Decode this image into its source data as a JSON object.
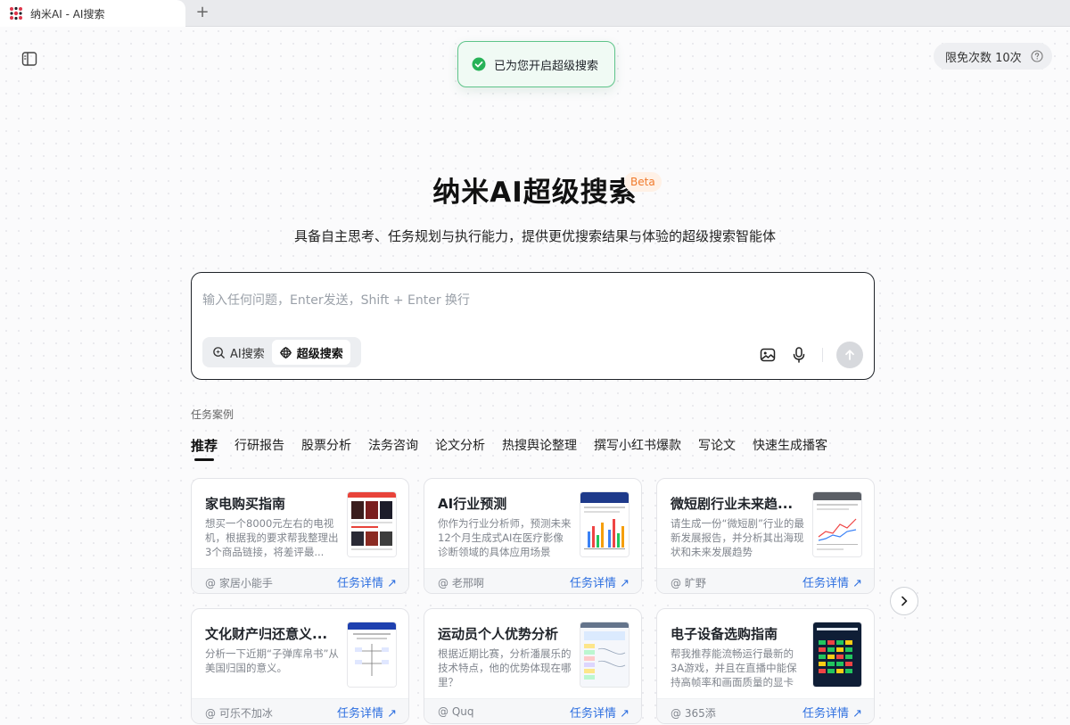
{
  "browser": {
    "tab_title": "纳米AI - AI搜索",
    "new_tab_label": "+"
  },
  "toast": {
    "text": "已为您开启超级搜索"
  },
  "quota": {
    "label": "限免次数 10次"
  },
  "hero": {
    "title": "纳米AI超级搜索",
    "badge": "Beta",
    "subtitle": "具备自主思考、任务规划与执行能力，提供更优搜索结果与体验的超级搜索智能体"
  },
  "search": {
    "placeholder": "输入任何问题，Enter发送，Shift + Enter 换行",
    "value": "",
    "modes": [
      {
        "label": "AI搜索",
        "icon": "ai-search-icon",
        "active": false
      },
      {
        "label": "超级搜索",
        "icon": "super-search-icon",
        "active": true
      }
    ]
  },
  "tasks": {
    "section_label": "任务案例",
    "categories": [
      "推荐",
      "行研报告",
      "股票分析",
      "法务咨询",
      "论文分析",
      "热搜舆论整理",
      "撰写小红书爆款",
      "写论文",
      "快速生成播客"
    ],
    "active_category": "推荐",
    "detail_label": "任务详情 ↗",
    "cards": [
      {
        "title": "家电购买指南",
        "desc": "想买一个8000元左右的电视机，根据我的要求帮我整理出3个商品链接，将差评最...",
        "author": "@ 家居小能手"
      },
      {
        "title": "AI行业预测",
        "desc": "你作为行业分析师，预测未来12个月生成式AI在医疗影像诊断领域的具体应用场景",
        "author": "@ 老邢啊"
      },
      {
        "title": "微短剧行业未来趋...",
        "desc": "请生成一份“微短剧”行业的最新发展报告，并分析其出海现状和未来发展趋势",
        "author": "@ 旷野"
      },
      {
        "title": "文化财产归还意义...",
        "desc": "分析一下近期“子弹库帛书”从美国归国的意义。",
        "author": "@ 可乐不加冰"
      },
      {
        "title": "运动员个人优势分析",
        "desc": "根据近期比赛，分析潘展乐的技术特点，他的优势体现在哪里？",
        "author": "@ Quq"
      },
      {
        "title": "电子设备选购指南",
        "desc": "帮我推荐能流畅运行最新的3A游戏，并且在直播中能保持高帧率和画面质量的显卡",
        "author": "@ 365添"
      }
    ]
  }
}
